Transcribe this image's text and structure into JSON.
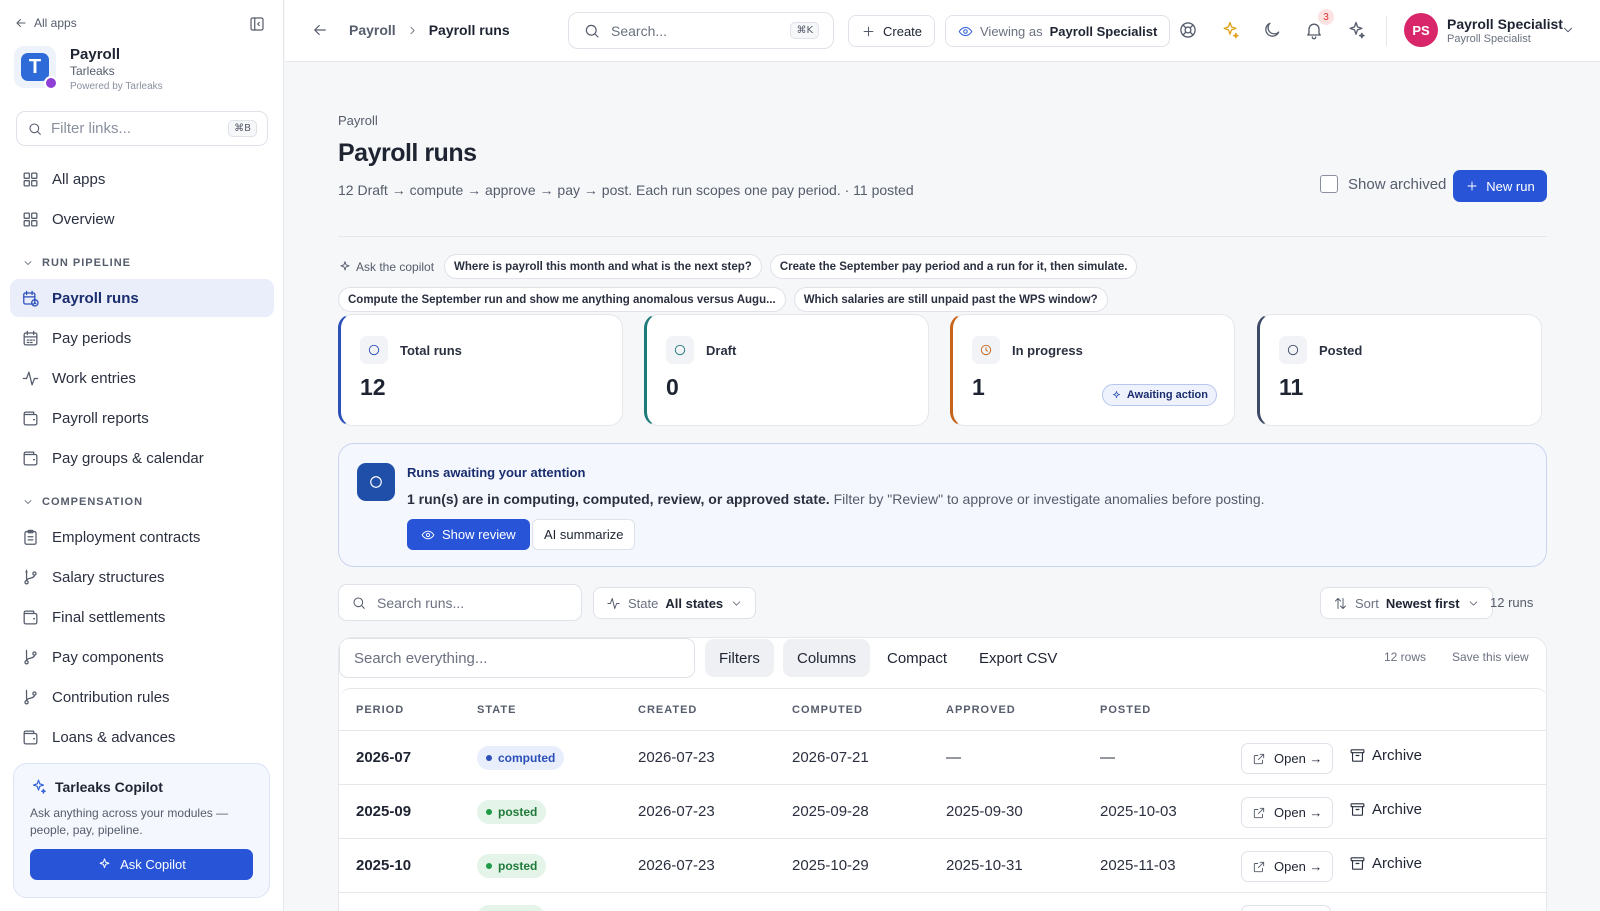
{
  "sidebar": {
    "all_apps_link": "All apps",
    "brand": {
      "title": "Payroll",
      "subtitle": "Tarleaks",
      "powered": "Powered by Tarleaks",
      "logo_letter": "T"
    },
    "filter": {
      "placeholder": "Filter links...",
      "shortcut": "⌘B"
    },
    "top_items": [
      {
        "label": "All apps",
        "icon": "grid-icon"
      },
      {
        "label": "Overview",
        "icon": "grid-icon"
      }
    ],
    "sections": [
      {
        "title": "RUN PIPELINE",
        "items": [
          {
            "label": "Payroll runs",
            "icon": "calendar-clock-icon",
            "active": true
          },
          {
            "label": "Pay periods",
            "icon": "calendar-icon"
          },
          {
            "label": "Work entries",
            "icon": "activity-icon"
          },
          {
            "label": "Payroll reports",
            "icon": "wallet-icon"
          },
          {
            "label": "Pay groups & calendar",
            "icon": "wallet-icon"
          }
        ]
      },
      {
        "title": "COMPENSATION",
        "items": [
          {
            "label": "Employment contracts",
            "icon": "clipboard-icon"
          },
          {
            "label": "Salary structures",
            "icon": "git-branch-icon"
          },
          {
            "label": "Final settlements",
            "icon": "wallet-icon"
          },
          {
            "label": "Pay components",
            "icon": "git-branch-icon"
          },
          {
            "label": "Contribution rules",
            "icon": "git-branch-icon"
          },
          {
            "label": "Loans & advances",
            "icon": "wallet-icon"
          }
        ]
      }
    ],
    "copilot": {
      "title": "Tarleaks Copilot",
      "description": "Ask anything across your modules — people, pay, pipeline.",
      "button": "Ask Copilot"
    }
  },
  "topbar": {
    "breadcrumb": [
      "Payroll",
      "Payroll runs"
    ],
    "search": {
      "placeholder": "Search...",
      "shortcut": "⌘K"
    },
    "create_label": "Create",
    "viewing_as": {
      "prefix": "Viewing as",
      "role": "Payroll Specialist"
    },
    "notification_count": "3",
    "user": {
      "initials": "PS",
      "name": "Payroll Specialist",
      "role": "Payroll Specialist"
    }
  },
  "page": {
    "crumb": "Payroll",
    "title": "Payroll runs",
    "description": "12 Draft → compute → approve → pay → post. Each run scopes one pay period. · 11 posted",
    "show_archived": "Show archived",
    "new_run": "New run",
    "copilot_label": "Ask the copilot",
    "prompts_row1": [
      "Where is payroll this month and what is the next step?",
      "Create the September pay period and a run for it, then simulate."
    ],
    "prompts_row2": [
      "Compute the September run and show me anything anomalous versus Augu...",
      "Which salaries are still unpaid past the WPS window?"
    ]
  },
  "stats": [
    {
      "label": "Total runs",
      "value": "12",
      "accent": "#2c4fb8",
      "icon": "circle-icon"
    },
    {
      "label": "Draft",
      "value": "0",
      "accent": "#1f7a7a",
      "icon": "circle-icon"
    },
    {
      "label": "In progress",
      "value": "1",
      "accent": "#c8641a",
      "icon": "clock-icon",
      "badge": "Awaiting action"
    },
    {
      "label": "Posted",
      "value": "11",
      "accent": "#3d4a66",
      "icon": "circle-icon"
    }
  ],
  "attention": {
    "title": "Runs awaiting your attention",
    "desc_bold": "1 run(s) are in computing, computed, review, or approved state.",
    "desc_rest": " Filter by \"Review\" to approve or investigate anomalies before posting.",
    "primary": "Show review",
    "secondary": "AI summarize"
  },
  "filters": {
    "search_placeholder": "Search runs...",
    "state_label": "State",
    "state_value": "All states",
    "sort_label": "Sort",
    "sort_value": "Newest first",
    "count": "12 runs"
  },
  "table": {
    "search_placeholder": "Search everything...",
    "toolbar": {
      "filters": "Filters",
      "columns": "Columns",
      "compact": "Compact",
      "export": "Export CSV"
    },
    "rows_count": "12 rows",
    "save_view": "Save this view",
    "columns": [
      "PERIOD",
      "STATE",
      "CREATED",
      "COMPUTED",
      "APPROVED",
      "POSTED"
    ],
    "open_label": "Open →",
    "archive_label": "Archive",
    "rows": [
      {
        "period": "2026-07",
        "state": "computed",
        "created": "2026-07-23",
        "computed": "2026-07-21",
        "approved": "—",
        "posted": "—"
      },
      {
        "period": "2025-09",
        "state": "posted",
        "created": "2026-07-23",
        "computed": "2025-09-28",
        "approved": "2025-09-30",
        "posted": "2025-10-03"
      },
      {
        "period": "2025-10",
        "state": "posted",
        "created": "2026-07-23",
        "computed": "2025-10-29",
        "approved": "2025-10-31",
        "posted": "2025-11-03"
      }
    ]
  },
  "colors": {
    "primary": "#2855d8",
    "computed_bg": "#e8eefb",
    "computed_fg": "#2c4fb8",
    "posted_bg": "#e4f4e8",
    "posted_fg": "#1f7a3a"
  }
}
